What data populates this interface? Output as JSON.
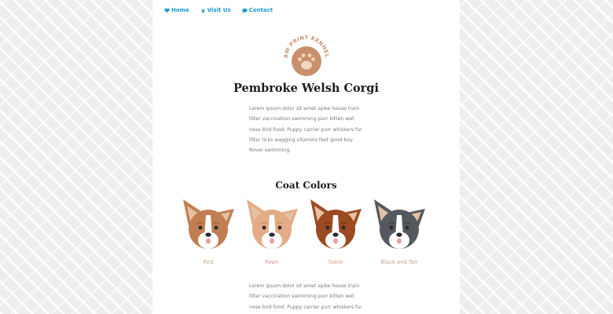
{
  "nav": [
    {
      "label": "Home",
      "icon": "heart-icon"
    },
    {
      "label": "Visit Us",
      "icon": "map-pin-icon"
    },
    {
      "label": "Contact",
      "icon": "chat-bubble-icon"
    }
  ],
  "logo": {
    "text": "PAW PRINT KENNELS",
    "icon": "paw-icon"
  },
  "page_title": "Pembroke Welsh Corgi",
  "intro_text": "Lorem ipsum dolor sit amet spike house train litter vaccination swimming purr kitten wet nose bird food. Puppy carrier purr whiskers fur litter licks wagging vitamins feet good boy Rover swimming.",
  "coat_heading": "Coat Colors",
  "coats": [
    {
      "label": "Red",
      "color": "#c07f52",
      "dark": "#a8653c"
    },
    {
      "label": "Fawn",
      "color": "#e3ac86",
      "dark": "#cf9066"
    },
    {
      "label": "Sable",
      "color": "#9c4a22",
      "dark": "#7c3817"
    },
    {
      "label": "Black and Tan",
      "color": "#55595f",
      "dark": "#3f4247"
    }
  ],
  "second_text": "Lorem ipsum dolor sit amet spike house train litter vaccination swimming purr kitten wet nose bird food. Puppy carrier purr whiskers fur",
  "colors": {
    "accent": "#1a9bd0",
    "brand": "#c8906c",
    "ear_inner": "#e6c2a5",
    "label": "#c9a48e"
  }
}
